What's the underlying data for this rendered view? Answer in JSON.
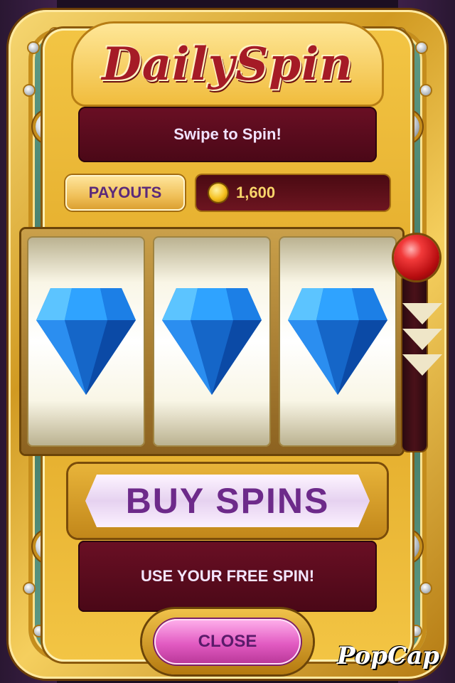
{
  "title": "DailySpin",
  "instruction": "Swipe to Spin!",
  "payouts_label": "PAYOUTS",
  "coin_balance": "1,600",
  "reels": [
    {
      "symbol": "blue-diamond-icon"
    },
    {
      "symbol": "blue-diamond-icon"
    },
    {
      "symbol": "blue-diamond-icon"
    }
  ],
  "buy_spins_label": "BUY SPINS",
  "free_spin_text": "USE YOUR FREE SPIN!",
  "close_label": "CLOSE",
  "brand": "PopCap",
  "colors": {
    "gold": "#e0a726",
    "plate": "#5a0c1d",
    "diamond": "#1e7fe0",
    "buy_text": "#6d2a8a",
    "close_button": "#e25bc2",
    "lever_ball": "#d01518"
  }
}
